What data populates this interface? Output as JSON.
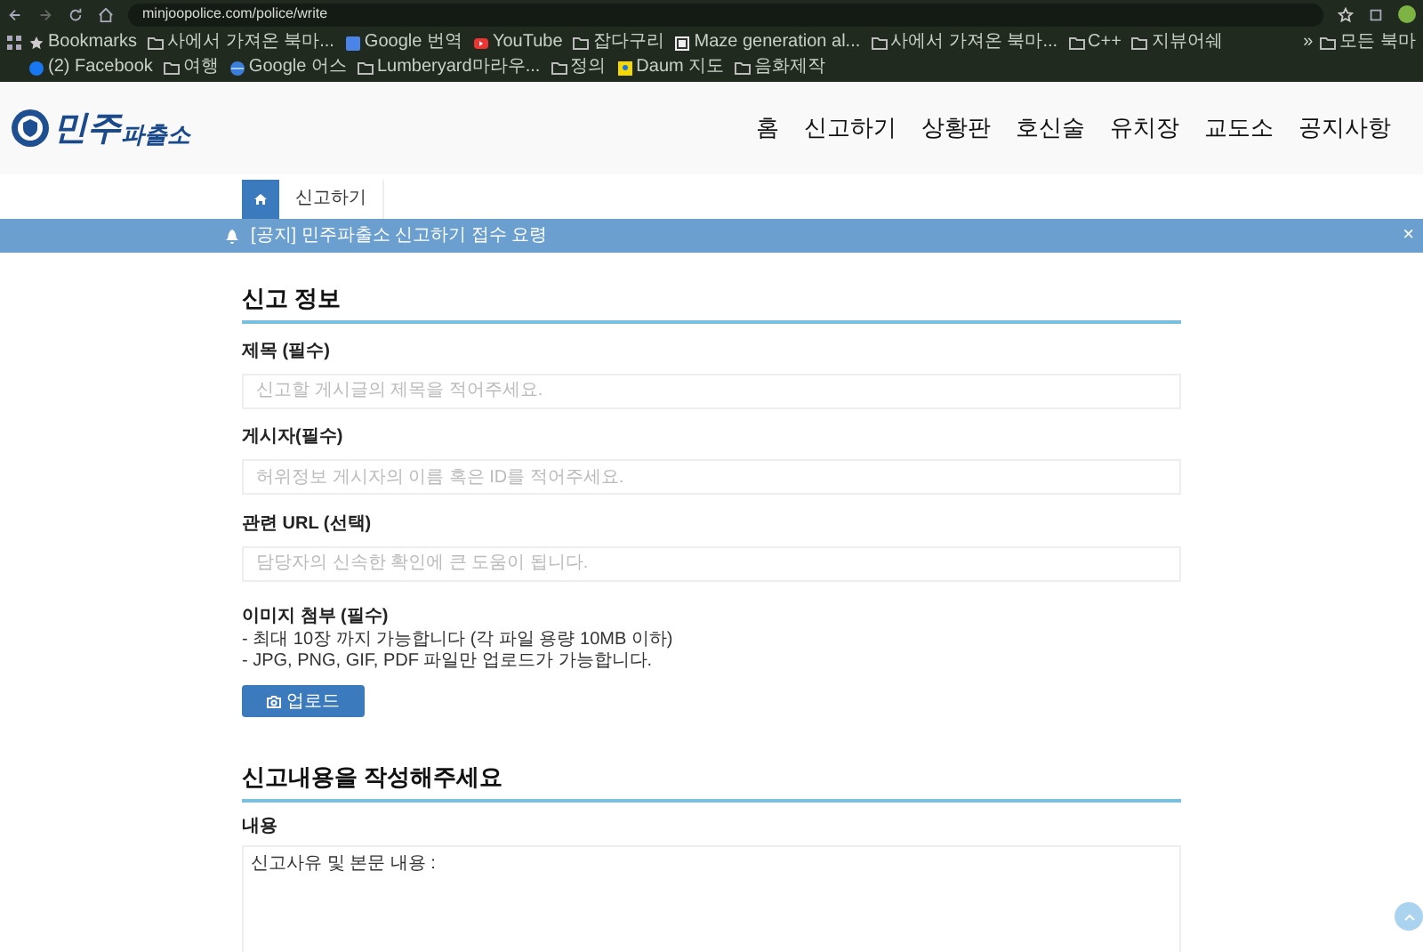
{
  "browser": {
    "url": "minjoopolice.com/police/write",
    "bookmarks": [
      {
        "label": "Bookmarks",
        "kind": "star"
      },
      {
        "label": "사에서 가져온 북마...",
        "kind": "folder"
      },
      {
        "label": "Google 번역",
        "kind": "translate"
      },
      {
        "label": "YouTube",
        "kind": "video"
      },
      {
        "label": "잡다구리",
        "kind": "folder"
      },
      {
        "label": "Maze generation al...",
        "kind": "site"
      },
      {
        "label": "사에서 가져온 북마...",
        "kind": "folder"
      },
      {
        "label": "C++",
        "kind": "folder"
      },
      {
        "label": "지뷰어쉐",
        "kind": "folder"
      },
      {
        "label": "(2) Facebook",
        "kind": "facebook"
      },
      {
        "label": "여행",
        "kind": "folder"
      },
      {
        "label": "Google 어스",
        "kind": "globe"
      },
      {
        "label": "Lumberyard마라우...",
        "kind": "folder"
      },
      {
        "label": "정의",
        "kind": "folder"
      },
      {
        "label": "Daum 지도",
        "kind": "map"
      },
      {
        "label": "음화제작",
        "kind": "folder"
      }
    ],
    "overflow": "»",
    "all_bookmarks": "모든 북마"
  },
  "header": {
    "logo_parts": [
      "민주",
      "파출소"
    ],
    "nav": [
      "홈",
      "신고하기",
      "상황판",
      "호신술",
      "유치장",
      "교도소",
      "공지사항"
    ]
  },
  "breadcrumb": {
    "current": "신고하기"
  },
  "notice": {
    "text": "[공지] 민주파출소 신고하기 접수 요령",
    "close": "×"
  },
  "report_info": {
    "title": "신고 정보",
    "fields": [
      {
        "label": "제목 (필수)",
        "placeholder": "신고할 게시글의 제목을 적어주세요."
      },
      {
        "label": "게시자(필수)",
        "placeholder": "허위정보 게시자의 이름 혹은 ID를 적어주세요."
      },
      {
        "label": "관련 URL (선택)",
        "placeholder": "담당자의 신속한 확인에 큰 도움이 됩니다."
      }
    ],
    "attachment": {
      "label": "이미지 첨부 (필수)",
      "notes": [
        "- 최대 10장 까지 가능합니다 (각 파일 용량 10MB 이하)",
        "- JPG, PNG, GIF, PDF 파일만 업로드가 가능합니다."
      ],
      "button": "업로드"
    }
  },
  "report_content": {
    "title": "신고내용을 작성해주세요",
    "label": "내용",
    "value": "신고사유 및 본문 내용 :"
  }
}
